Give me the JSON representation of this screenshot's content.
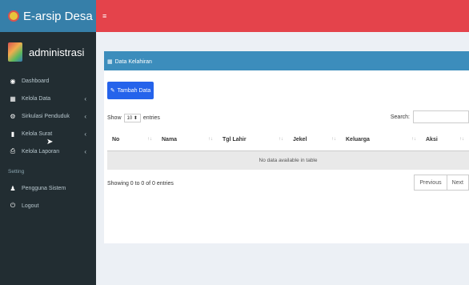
{
  "brand": {
    "title": "E-arsip Desa"
  },
  "user": {
    "name": "administrasi"
  },
  "sidebar": {
    "items": [
      {
        "label": "Dashboard",
        "icon": "dashboard-icon"
      },
      {
        "label": "Kelola Data",
        "icon": "table-icon"
      },
      {
        "label": "Sirkulasi Penduduk",
        "icon": "gears-icon"
      },
      {
        "label": "Kelola Surat",
        "icon": "document-icon"
      },
      {
        "label": "Kelola Laporan",
        "icon": "print-icon"
      }
    ],
    "section": "Setting",
    "settings": [
      {
        "label": "Pengguna Sistem",
        "icon": "user-icon"
      },
      {
        "label": "Logout",
        "icon": "power-icon"
      }
    ]
  },
  "topbar": {
    "toggle": "≡"
  },
  "box": {
    "title": "Data Kelahiran",
    "add_button": "Tambah Data",
    "length": {
      "show": "Show",
      "value": "10",
      "entries": "entries"
    },
    "search_label": "Search:",
    "columns": [
      "No",
      "Nama",
      "Tgl Lahir",
      "Jekel",
      "Keluarga",
      "Aksi"
    ],
    "empty_text": "No data available in table",
    "info": "Showing 0 to 0 of 0 entries",
    "pager": {
      "previous": "Previous",
      "next": "Next"
    }
  },
  "colors": {
    "topbar": "#e4434b",
    "brand": "#367fa9",
    "sidebar": "#222d32",
    "primary": "#3c8dbc",
    "button": "#2563eb"
  }
}
